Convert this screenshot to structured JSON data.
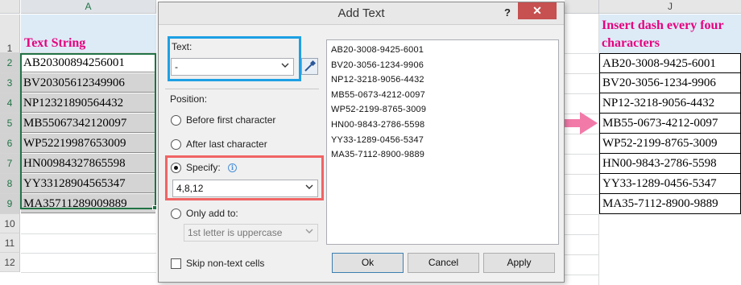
{
  "sheet_left": {
    "column": "A",
    "rows": [
      "1",
      "2",
      "3",
      "4",
      "5",
      "6",
      "7",
      "8",
      "9",
      "10",
      "11",
      "12"
    ],
    "header": "Text String",
    "values": [
      "AB20300894256001",
      "BV20305612349906",
      "NP12321890564432",
      "MB55067342120097",
      "WP52219987653009",
      "HN00984327865598",
      "YY33128904565347",
      "MA35711289009889"
    ]
  },
  "sheet_right": {
    "column": "J",
    "header": "Insert dash every four characters",
    "values": [
      "AB20-3008-9425-6001",
      "BV20-3056-1234-9906",
      "NP12-3218-9056-4432",
      "MB55-0673-4212-0097",
      "WP52-2199-8765-3009",
      "HN00-9843-2786-5598",
      "YY33-1289-0456-5347",
      "MA35-7112-8900-9889"
    ]
  },
  "dialog": {
    "title": "Add Text",
    "help": "?",
    "close": "✕",
    "text_label": "Text:",
    "text_value": "-",
    "position_label": "Position:",
    "options": {
      "before_first": "Before first character",
      "after_last": "After last character",
      "specify": "Specify:",
      "only_add_to": "Only add to:"
    },
    "selected_option": "specify",
    "specify_value": "4,8,12",
    "only_add_to_value": "1st letter is uppercase",
    "skip_non_text": "Skip non-text cells",
    "skip_checked": false,
    "preview_lines": [
      "AB20-3008-9425-6001",
      "BV20-3056-1234-9906",
      "NP12-3218-9056-4432",
      "MB55-0673-4212-0097",
      "WP52-2199-8765-3009",
      "HN00-9843-2786-5598",
      "YY33-1289-0456-5347",
      "MA35-7112-8900-9889"
    ],
    "buttons": {
      "ok": "Ok",
      "cancel": "Cancel",
      "apply": "Apply"
    }
  },
  "colors": {
    "accent_pink": "#e6007e",
    "excel_green": "#217346",
    "text_frame": "#1ea0e4",
    "specify_frame": "#f06464",
    "arrow": "#f27aa9"
  }
}
